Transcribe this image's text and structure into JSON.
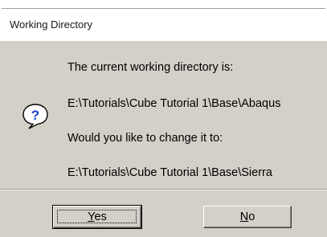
{
  "window": {
    "title": "Working Directory"
  },
  "message": {
    "line1": "The current working directory is:",
    "current_path": "E:\\Tutorials\\Cube Tutorial 1\\Base\\Abaqus",
    "line2": "Would you like to change it to:",
    "new_path": "E:\\Tutorials\\Cube Tutorial 1\\Base\\Sierra"
  },
  "buttons": {
    "yes_mnemonic": "Y",
    "yes_rest": "es",
    "no_mnemonic": "N",
    "no_rest": "o"
  },
  "icon": "question-icon",
  "colors": {
    "body_bg": "#d4d0c8",
    "icon_blue": "#1a3fd0"
  }
}
